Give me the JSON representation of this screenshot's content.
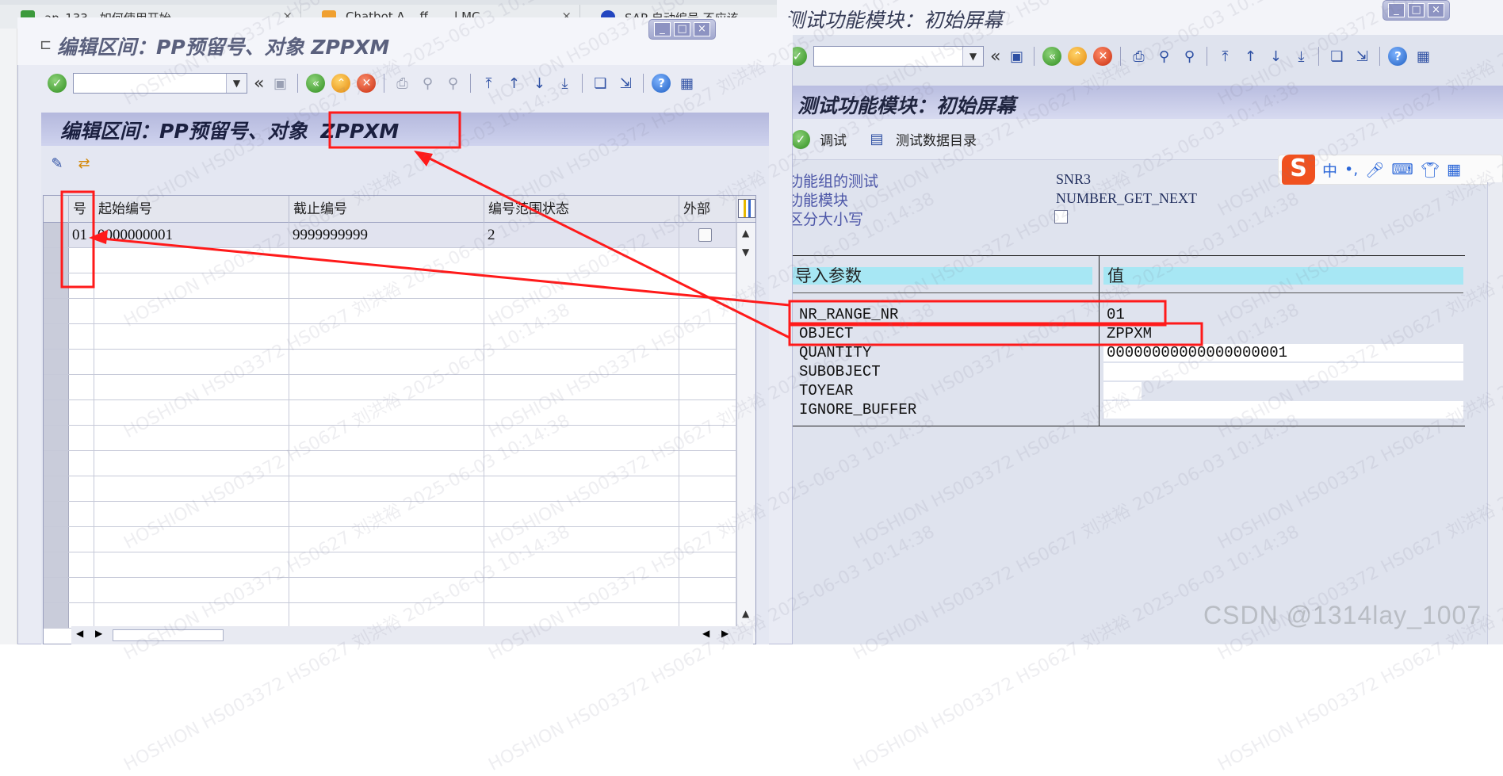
{
  "browser": {
    "tabs": [
      {
        "label": "ap_133 - 如何使用开始",
        "icon": "green-feather-icon"
      },
      {
        "label": "Chatbot A... ff... ...l MC",
        "icon": "orange-hex-icon"
      },
      {
        "label": "SAP 自动编号 不应该",
        "icon": "paw-icon"
      }
    ],
    "close_glyph": "×"
  },
  "right_window": {
    "title": "测试功能模块：初始屏幕",
    "screen_title": "测试功能模块：初始屏幕",
    "app_toolbar": {
      "debug_label": "调试",
      "test_data_dir_label": "测试数据目录"
    },
    "fields": [
      {
        "label": "功能组的测试",
        "value": "SNR3"
      },
      {
        "label": "功能模块",
        "value": "NUMBER_GET_NEXT"
      },
      {
        "label": "区分大小写",
        "value": ""
      }
    ],
    "params": {
      "header_name": "导入参数",
      "header_value": "值",
      "rows": [
        {
          "name": "NR_RANGE_NR",
          "value": "01"
        },
        {
          "name": "OBJECT",
          "value": "ZPPXM"
        },
        {
          "name": "QUANTITY",
          "value": "00000000000000000001"
        },
        {
          "name": "SUBOBJECT",
          "value": ""
        },
        {
          "name": "TOYEAR",
          "value": ""
        },
        {
          "name": "IGNORE_BUFFER",
          "value": ""
        }
      ]
    }
  },
  "ime": {
    "logo": "S",
    "lang": "中",
    "punct": "•,"
  },
  "left_window": {
    "title": "编辑区间：PP预留号、对象 ZPPXM",
    "panel_title_prefix": "编辑区间：PP预留号、对象",
    "panel_title_object": "ZPPXM",
    "grid": {
      "headers": [
        "号",
        "起始编号",
        "截止编号",
        "编号范围状态",
        "外部"
      ],
      "rows": [
        {
          "no": "01",
          "from": "0000000001",
          "to": "9999999999",
          "status": "2",
          "external": false
        }
      ]
    }
  },
  "watermark": "HOSHION HS003372 HS0627 刘洪裕 2025-06-03 10:14:38",
  "csdn_credit": "CSDN @1314lay_1007",
  "colors": {
    "sap_band": "#b9bde0",
    "param_header": "#a7e7f4",
    "annotation_red": "#ff1a1a"
  }
}
